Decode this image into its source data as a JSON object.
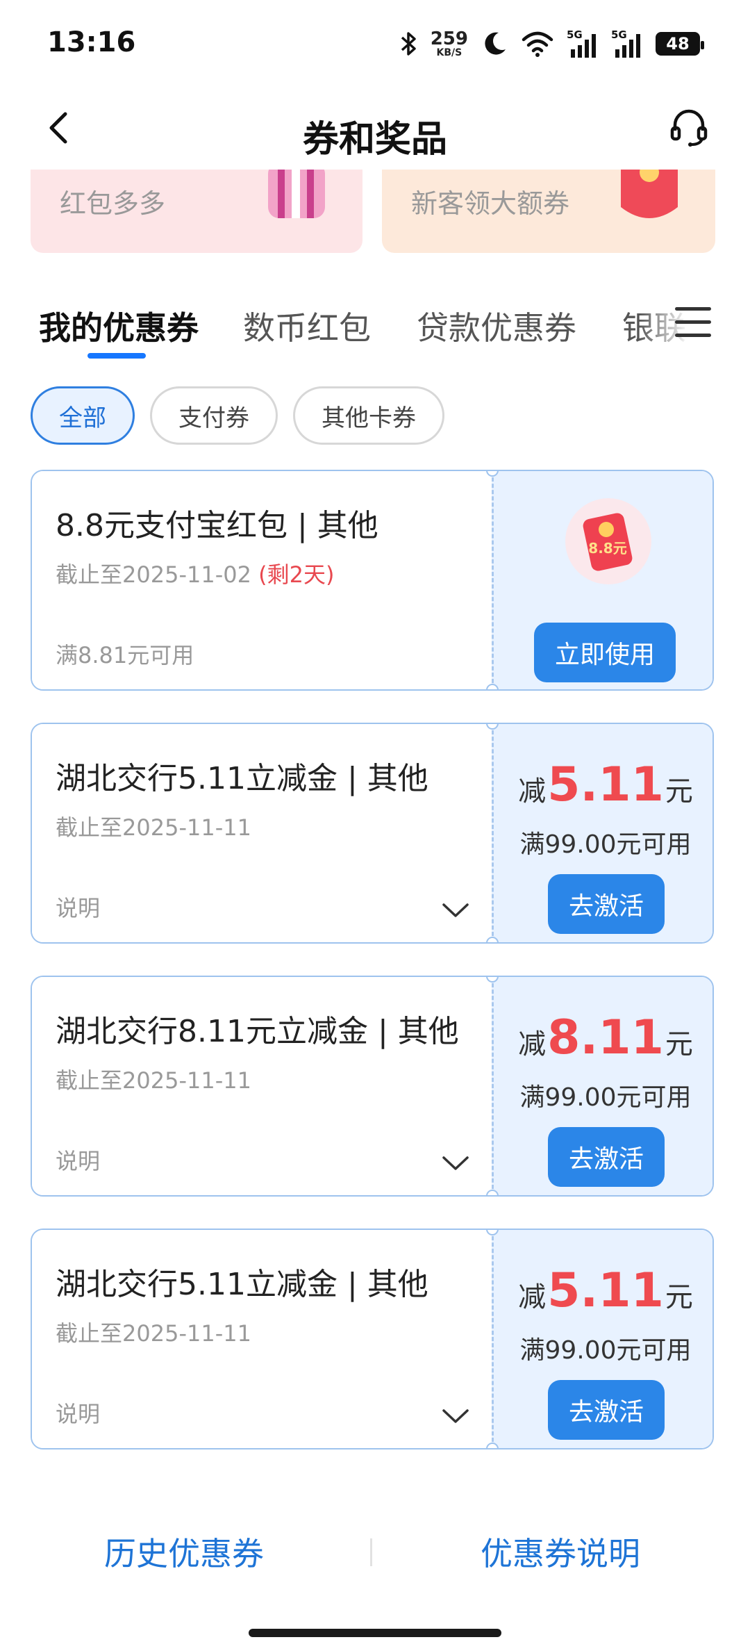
{
  "status_bar": {
    "time": "13:16",
    "speed_value": "259",
    "speed_unit": "KB/S",
    "battery": "48"
  },
  "nav": {
    "title": "券和奖品"
  },
  "promos": [
    {
      "label": "红包多多"
    },
    {
      "label": "新客领大额券"
    }
  ],
  "tabs": [
    {
      "label": "我的优惠券",
      "active": true
    },
    {
      "label": "数币红包"
    },
    {
      "label": "贷款优惠券"
    },
    {
      "label": "银联"
    }
  ],
  "filters": [
    {
      "label": "全部",
      "active": true
    },
    {
      "label": "支付券"
    },
    {
      "label": "其他卡券"
    }
  ],
  "coupons": [
    {
      "title": "8.8元支付宝红包 | 其他",
      "date": "截止至2025-11-02",
      "remaining": "(剩2天)",
      "note": "满8.81元可用",
      "button": "立即使用",
      "image_text": "8.8元"
    },
    {
      "title": "湖北交行5.11立减金 | 其他",
      "date": "截止至2025-11-11",
      "note": "说明",
      "reduce_prefix": "减",
      "amount": "5.11",
      "unit": "元",
      "threshold": "满99.00元可用",
      "button": "去激活"
    },
    {
      "title": "湖北交行8.11元立减金 | 其他",
      "date": "截止至2025-11-11",
      "note": "说明",
      "reduce_prefix": "减",
      "amount": "8.11",
      "unit": "元",
      "threshold": "满99.00元可用",
      "button": "去激活"
    },
    {
      "title": "湖北交行5.11立减金 | 其他",
      "date": "截止至2025-11-11",
      "note": "说明",
      "reduce_prefix": "减",
      "amount": "5.11",
      "unit": "元",
      "threshold": "满99.00元可用",
      "button": "去激活"
    }
  ],
  "footer": {
    "history": "历史优惠券",
    "explain": "优惠券说明"
  },
  "colors": {
    "accent": "#2b86e8",
    "amount": "#ef4a4f",
    "card_right_bg": "#e8f2ff"
  }
}
